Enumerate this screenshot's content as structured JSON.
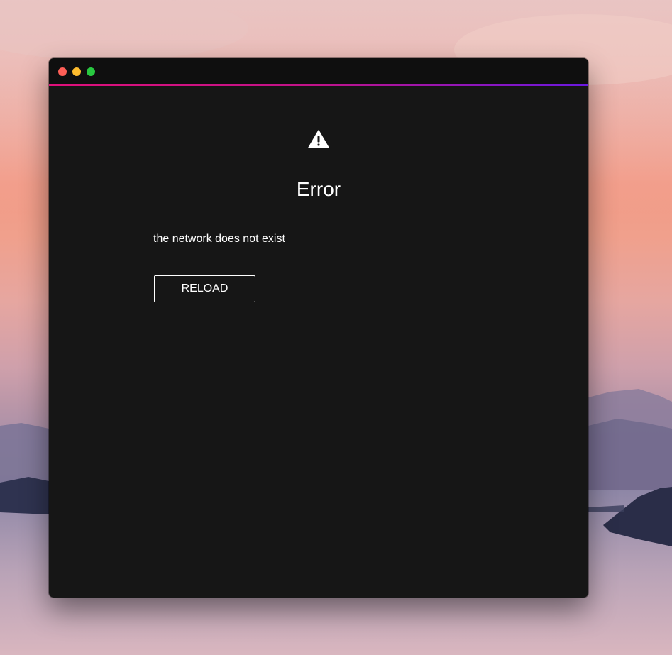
{
  "window": {
    "controls": {
      "close": "close-button",
      "minimize": "minimize-button",
      "zoom": "zoom-button"
    }
  },
  "error": {
    "icon": "warning-icon",
    "title": "Error",
    "message": "the network does not exist",
    "reload_label": "RELOAD"
  },
  "colors": {
    "window_background": "#161616",
    "titlebar_background": "#0f0f0f",
    "accent_gradient_start": "#e0107a",
    "accent_gradient_end": "#6a18e0",
    "text": "#ffffff",
    "traffic_close": "#ff5f57",
    "traffic_minimize": "#febc2e",
    "traffic_zoom": "#28c840"
  }
}
